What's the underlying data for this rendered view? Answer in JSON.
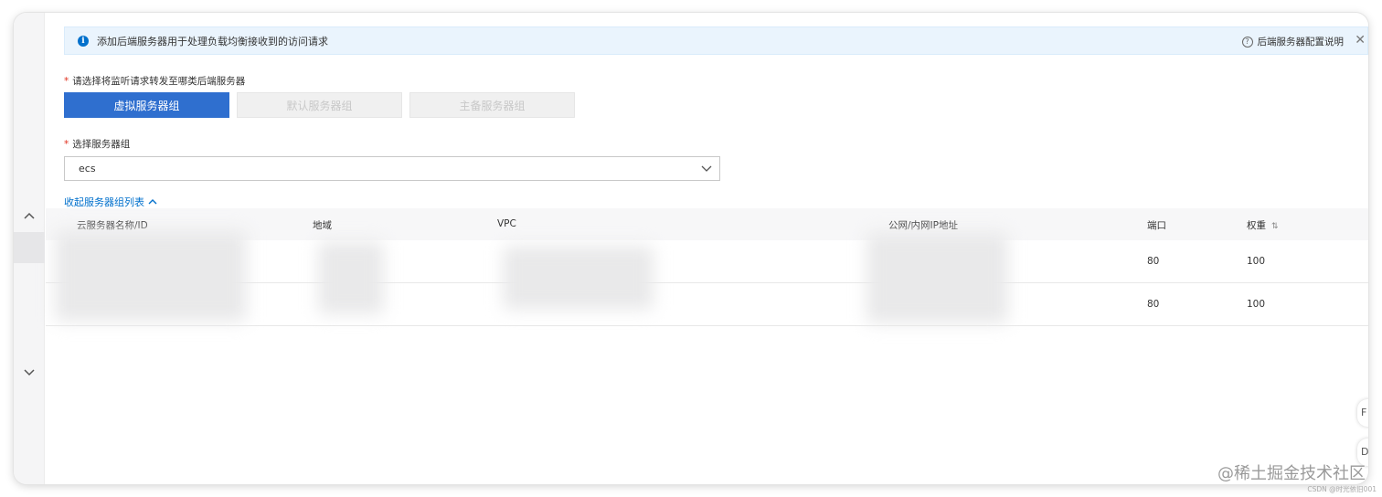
{
  "notice": {
    "text": "添加后端服务器用于处理负载均衡接收到的访问请求",
    "help_link": "后端服务器配置说明",
    "close_glyph": "✕",
    "info_glyph": "i",
    "help_glyph": "?"
  },
  "form": {
    "server_type_label": "请选择将监听请求转发至哪类后端服务器",
    "required_mark": "*",
    "server_types": [
      "虚拟服务器组",
      "默认服务器组",
      "主备服务器组"
    ],
    "server_group_label": "选择服务器组",
    "server_group_value": "ecs",
    "collapse_link": "收起服务器组列表"
  },
  "table": {
    "columns": [
      "云服务器名称/ID",
      "地域",
      "VPC",
      "公网/内网IP地址",
      "端口",
      "权重"
    ],
    "rows": [
      {
        "port": "80",
        "weight": "100"
      },
      {
        "port": "80",
        "weight": "100"
      }
    ]
  },
  "rail": {
    "up_glyph": "︿",
    "down_glyph": "﹀"
  },
  "side_float": [
    "F",
    "D"
  ],
  "watermark": "@稀土掘金技术社区",
  "watermark_sub": "CSDN @时光依旧001",
  "colors": {
    "primary": "#2f6fcf",
    "link": "#0070cc",
    "notice_bg": "#eaf4fd",
    "required": "#e0301e"
  }
}
